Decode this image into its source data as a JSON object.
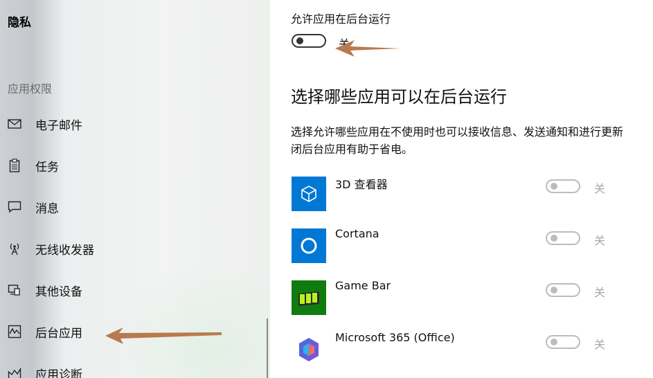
{
  "sidebar": {
    "title": "隐私",
    "section_label": "应用权限",
    "items": [
      {
        "label": "电子邮件",
        "icon": "mail-icon"
      },
      {
        "label": "任务",
        "icon": "clipboard-icon"
      },
      {
        "label": "消息",
        "icon": "message-icon"
      },
      {
        "label": "无线收发器",
        "icon": "radio-antenna-icon"
      },
      {
        "label": "其他设备",
        "icon": "devices-icon"
      },
      {
        "label": "后台应用",
        "icon": "activity-icon"
      },
      {
        "label": "应用诊断",
        "icon": "diagnostics-icon"
      }
    ]
  },
  "main": {
    "allow_label": "允许应用在后台运行",
    "allow_toggle_state": "关",
    "heading": "选择哪些应用可以在后台运行",
    "desc_line1": "选择允许哪些应用在不使用时也可以接收信息、发送通知和进行更新",
    "desc_line2": "闭后台应用有助于省电。",
    "apps": [
      {
        "name": "3D 查看器",
        "state": "关",
        "icon": "3d-viewer-icon",
        "color": "#0078d4"
      },
      {
        "name": "Cortana",
        "state": "关",
        "icon": "cortana-icon",
        "color": "#0078d4"
      },
      {
        "name": "Game Bar",
        "state": "关",
        "icon": "game-bar-icon",
        "color": "#107c10"
      },
      {
        "name": "Microsoft 365 (Office)",
        "state": "关",
        "icon": "microsoft-365-icon",
        "color": "#ffffff"
      }
    ]
  },
  "annotation_color": "#b87a4e"
}
